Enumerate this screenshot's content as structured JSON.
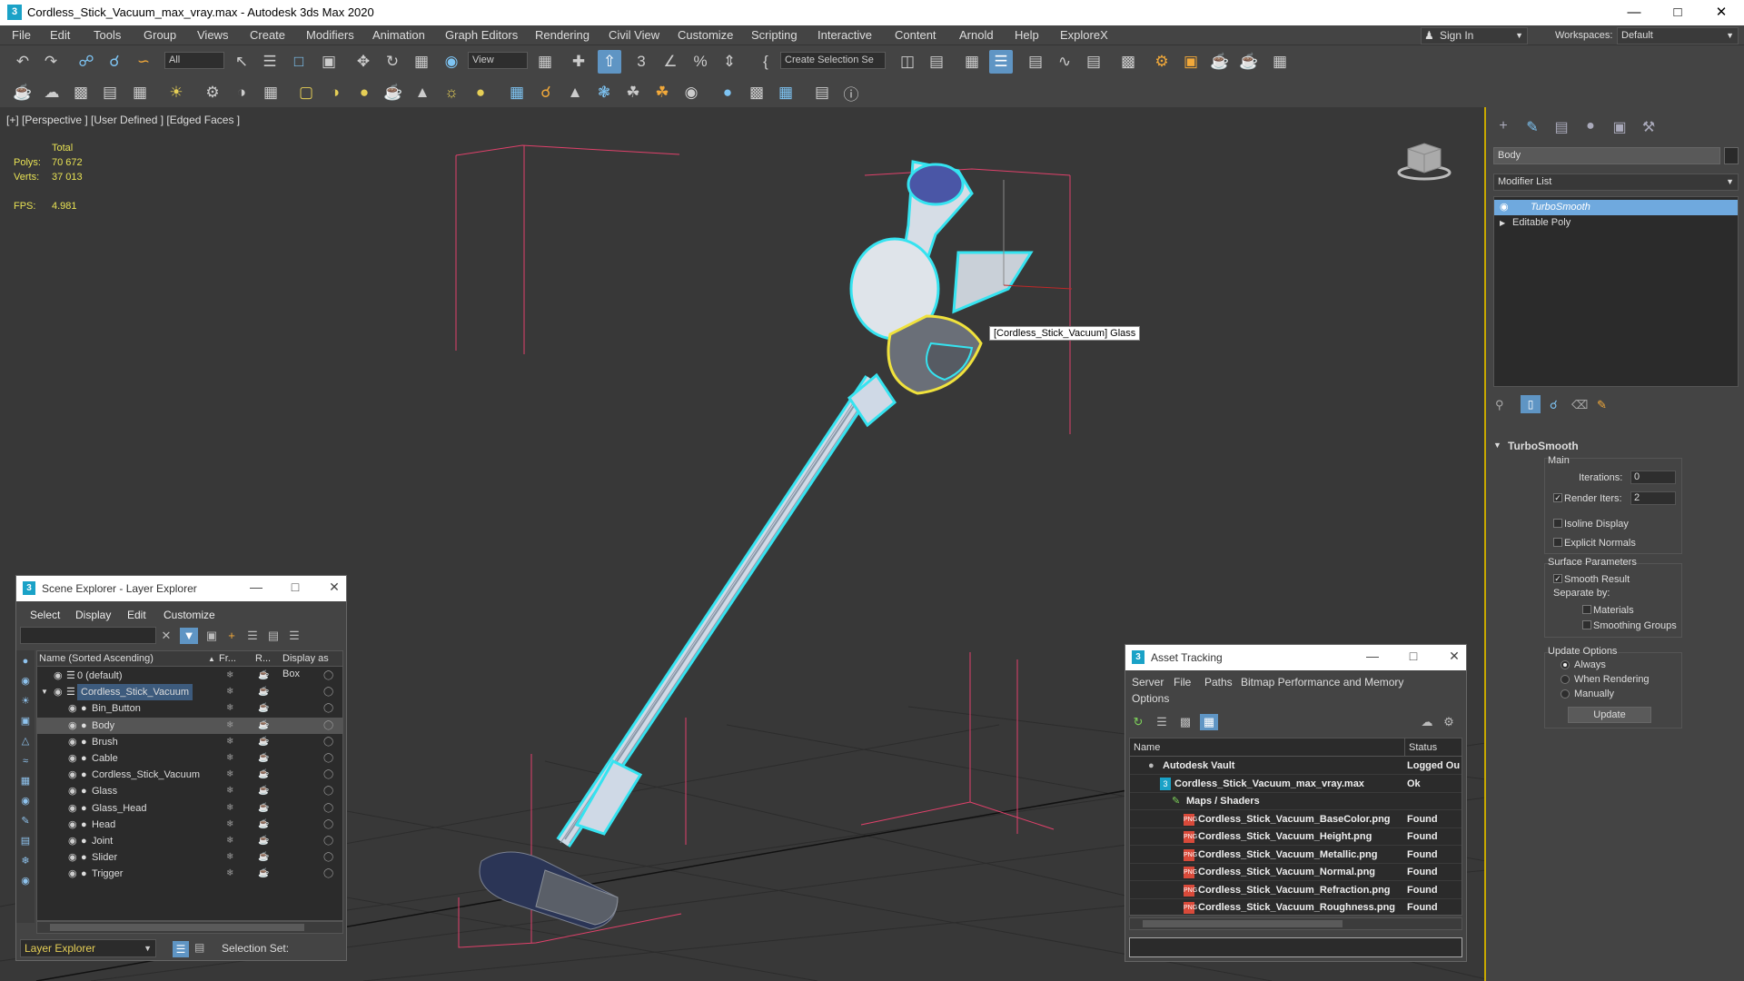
{
  "window": {
    "title": "Cordless_Stick_Vacuum_max_vray.max - Autodesk 3ds Max 2020",
    "app_icon": "3"
  },
  "menu": [
    "File",
    "Edit",
    "Tools",
    "Group",
    "Views",
    "Create",
    "Modifiers",
    "Animation",
    "Graph Editors",
    "Rendering",
    "Civil View",
    "Customize",
    "Scripting",
    "Interactive",
    "Content",
    "Arnold",
    "Help",
    "ExploreX"
  ],
  "account": {
    "sign_in": "Sign In",
    "workspaces_label": "Workspaces:",
    "workspace": "Default"
  },
  "toolbar": {
    "filter": "All",
    "ref_coord": "View",
    "selection_set": "Create Selection Se"
  },
  "viewport": {
    "label": "[+] [Perspective ] [User Defined ] [Edged Faces ]",
    "stats": {
      "total_label": "Total",
      "polys_label": "Polys:",
      "polys": "70 672",
      "verts_label": "Verts:",
      "verts": "37 013",
      "fps_label": "FPS:",
      "fps": "4.981"
    },
    "tooltip": "[Cordless_Stick_Vacuum] Glass",
    "colors": {
      "selection": "#35e3f0",
      "glass": "#f0e23c",
      "bbox": "#e0416b",
      "grid": "#2b2b2b"
    }
  },
  "command_panel": {
    "object_name": "Body",
    "modifier_list": "Modifier List",
    "stack": [
      "TurboSmooth",
      "Editable Poly"
    ],
    "rollout_title": "TurboSmooth",
    "main_title": "Main",
    "iterations_label": "Iterations:",
    "iterations": "0",
    "render_iters_label": "Render Iters:",
    "render_iters": "2",
    "isoline": "Isoline Display",
    "explicit_normals": "Explicit Normals",
    "surface_params": "Surface Parameters",
    "smooth_result": "Smooth Result",
    "separate_by": "Separate by:",
    "materials": "Materials",
    "smoothing_groups": "Smoothing Groups",
    "update_options": "Update Options",
    "always": "Always",
    "when_rendering": "When Rendering",
    "manually": "Manually",
    "update_btn": "Update"
  },
  "scene_explorer": {
    "title": "Scene Explorer - Layer Explorer",
    "menu": [
      "Select",
      "Display",
      "Edit",
      "Customize"
    ],
    "col_name": "Name (Sorted Ascending)",
    "col_fr": "Fr...",
    "col_r": "R...",
    "col_box": "Display as Box",
    "rows": [
      {
        "name": "0 (default)",
        "level": 0
      },
      {
        "name": "Cordless_Stick_Vacuum",
        "level": 0
      },
      {
        "name": "Bin_Button",
        "level": 1
      },
      {
        "name": "Body",
        "level": 1
      },
      {
        "name": "Brush",
        "level": 1
      },
      {
        "name": "Cable",
        "level": 1
      },
      {
        "name": "Cordless_Stick_Vacuum",
        "level": 1
      },
      {
        "name": "Glass",
        "level": 1
      },
      {
        "name": "Glass_Head",
        "level": 1
      },
      {
        "name": "Head",
        "level": 1
      },
      {
        "name": "Joint",
        "level": 1
      },
      {
        "name": "Slider",
        "level": 1
      },
      {
        "name": "Trigger",
        "level": 1
      }
    ],
    "footer_mode": "Layer Explorer",
    "selection_set_label": "Selection Set:"
  },
  "asset_tracking": {
    "title": "Asset Tracking",
    "menu": [
      "Server",
      "File",
      "Paths",
      "Bitmap Performance and Memory",
      "Options"
    ],
    "col_name": "Name",
    "col_status": "Status",
    "rows": [
      {
        "name": "Autodesk Vault",
        "status": "Logged Ou",
        "indent": 0
      },
      {
        "name": "Cordless_Stick_Vacuum_max_vray.max",
        "status": "Ok",
        "indent": 1
      },
      {
        "name": "Maps / Shaders",
        "status": "",
        "indent": 2
      },
      {
        "name": "Cordless_Stick_Vacuum_BaseColor.png",
        "status": "Found",
        "indent": 3
      },
      {
        "name": "Cordless_Stick_Vacuum_Height.png",
        "status": "Found",
        "indent": 3
      },
      {
        "name": "Cordless_Stick_Vacuum_Metallic.png",
        "status": "Found",
        "indent": 3
      },
      {
        "name": "Cordless_Stick_Vacuum_Normal.png",
        "status": "Found",
        "indent": 3
      },
      {
        "name": "Cordless_Stick_Vacuum_Refraction.png",
        "status": "Found",
        "indent": 3
      },
      {
        "name": "Cordless_Stick_Vacuum_Roughness.png",
        "status": "Found",
        "indent": 3
      }
    ]
  }
}
